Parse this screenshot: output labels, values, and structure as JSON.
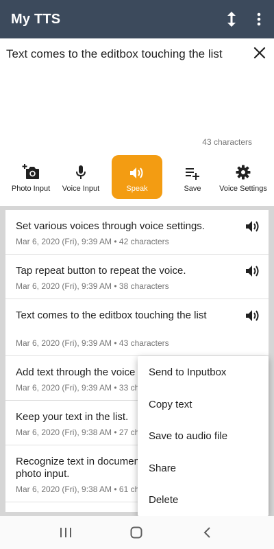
{
  "app": {
    "title": "My TTS"
  },
  "editor": {
    "text": "Text comes to the editbox touching the list",
    "char_count": "43 characters"
  },
  "toolbar": {
    "photo_input": "Photo Input",
    "voice_input": "Voice Input",
    "speak": "Speak",
    "save": "Save",
    "voice_settings": "Voice Settings",
    "speak_color": "#f39c12"
  },
  "list": {
    "items": [
      {
        "text": "Set various voices through voice settings.",
        "meta": "Mar 6, 2020 (Fri), 9:39 AM  •  42 characters"
      },
      {
        "text": "Tap repeat button to repeat the voice.",
        "meta": "Mar 6, 2020 (Fri), 9:39 AM  •  38 characters"
      },
      {
        "text": "Text comes to the editbox touching the list",
        "meta": "Mar 6, 2020 (Fri), 9:39 AM  •  43 characters"
      },
      {
        "text": "Add text through the voice input.",
        "meta": "Mar 6, 2020 (Fri), 9:39 AM  •  33 characters"
      },
      {
        "text": "Keep your text in the list.",
        "meta": "Mar 6, 2020 (Fri), 9:38 AM  •  27 characters"
      },
      {
        "text": "Recognize text in documents through the photo input.",
        "meta": "Mar 6, 2020 (Fri), 9:38 AM  •  61 characters"
      }
    ]
  },
  "context_menu": {
    "send_to_inputbox": "Send to Inputbox",
    "copy_text": "Copy text",
    "save_to_audio_file": "Save to audio file",
    "share": "Share",
    "delete": "Delete"
  },
  "colors": {
    "appbar": "#3c4a5c",
    "accent": "#f39c12"
  }
}
